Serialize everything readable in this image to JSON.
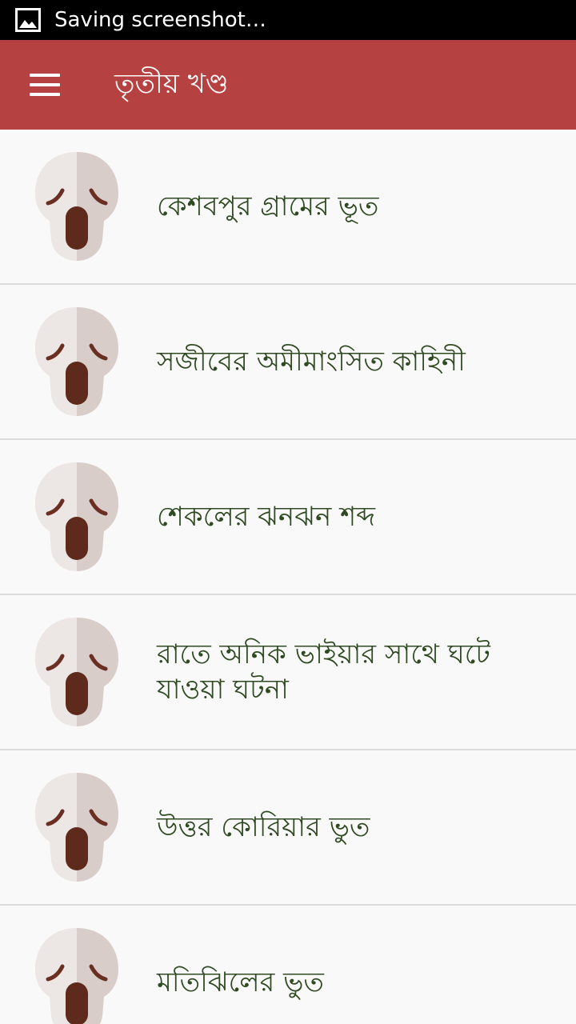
{
  "status_bar": {
    "notification_icon": "image-icon",
    "text": "Saving screenshot…"
  },
  "app_bar": {
    "menu_icon": "hamburger-menu-icon",
    "title": "তৃতীয় খণ্ড"
  },
  "list": {
    "item_icon": "ghost-face-icon",
    "items": [
      {
        "title": "কেশবপুর গ্রামের ভূত"
      },
      {
        "title": "সজীবের অমীমাংসিত কাহিনী"
      },
      {
        "title": "শেকলের ঝনঝন শব্দ"
      },
      {
        "title": "রাতে অনিক ভাইয়ার সাথে ঘটে যাওয়া ঘটনা"
      },
      {
        "title": "উত্তর কোরিয়ার ভুত"
      },
      {
        "title": "মতিঝিলের ভুত"
      }
    ]
  },
  "colors": {
    "app_bar": "#b54141",
    "status_bar": "#000000",
    "item_text": "#2f4a22",
    "background": "#f9f9f9",
    "divider": "#dcdcdc"
  }
}
